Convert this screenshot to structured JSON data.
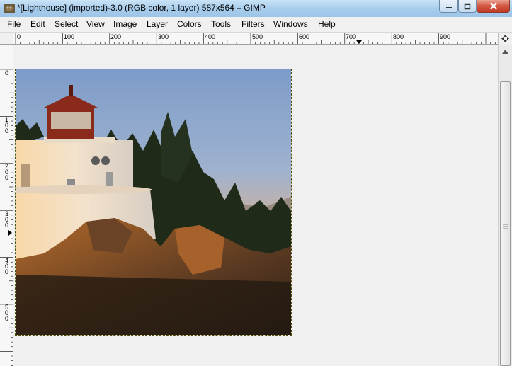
{
  "window": {
    "title": "*[Lighthouse] (imported)-3.0 (RGB color, 1 layer) 587x564 – GIMP",
    "app_icon": "gimp-icon",
    "controls": [
      "minimize-icon",
      "maximize-icon",
      "close-icon"
    ]
  },
  "menu": {
    "items": [
      {
        "label": "File"
      },
      {
        "label": "Edit"
      },
      {
        "label": "Select"
      },
      {
        "label": "View"
      },
      {
        "label": "Image"
      },
      {
        "label": "Layer"
      },
      {
        "label": "Colors"
      },
      {
        "label": "Tools"
      },
      {
        "label": "Filters"
      },
      {
        "label": "Windows"
      },
      {
        "label": "Help"
      }
    ]
  },
  "ruler": {
    "horizontal_labels": [
      "0",
      "100",
      "200",
      "300",
      "400",
      "500",
      "600",
      "700",
      "800",
      "900"
    ],
    "vertical_labels": [
      "0",
      "100",
      "200",
      "300",
      "400",
      "500"
    ]
  },
  "canvas": {
    "image_name": "Lighthouse",
    "image_size": "587x564",
    "colors": {
      "sky_top": "#7d9cc9",
      "sky_horizon": "#e9b27a",
      "tower_white": "#f3e2cc",
      "lantern_red": "#8a2a1a",
      "rocks": "#3a2a1d",
      "trees": "#1f2a18",
      "selection": "#4a4a00"
    }
  },
  "scrollbar": {
    "icons": [
      "navigate-icon",
      "scroll-up-icon"
    ]
  }
}
